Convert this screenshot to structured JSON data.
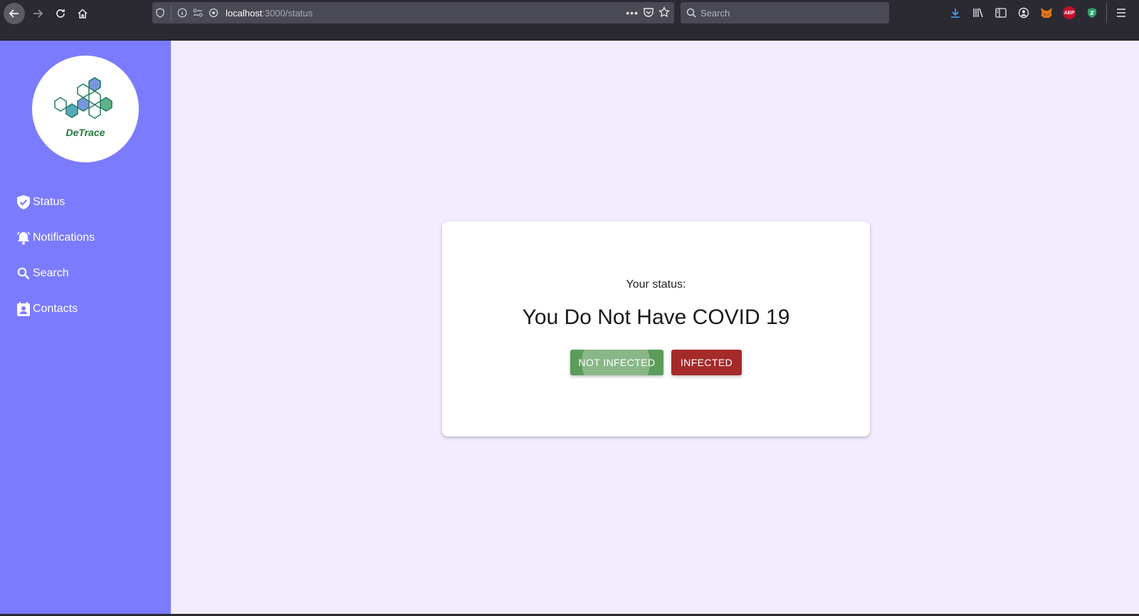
{
  "browser": {
    "url_host": "localhost",
    "url_path": ":3000/status",
    "search_placeholder": "Search",
    "abp_badge": "ABP"
  },
  "sidebar": {
    "logo_text": "DeTrace",
    "items": [
      {
        "label": "Status",
        "icon": "shield-check-icon"
      },
      {
        "label": "Notifications",
        "icon": "bell-icon"
      },
      {
        "label": "Search",
        "icon": "search-icon"
      },
      {
        "label": "Contacts",
        "icon": "contact-card-icon"
      }
    ]
  },
  "card": {
    "label": "Your status:",
    "status": "You Do Not Have COVID 19",
    "buttons": {
      "not_infected": "NOT INFECTED",
      "infected": "INFECTED"
    }
  },
  "colors": {
    "sidebar": "#7b7bff",
    "background": "#f3ecfe",
    "not_infected": "#5c9c5a",
    "infected": "#a52a2a"
  }
}
